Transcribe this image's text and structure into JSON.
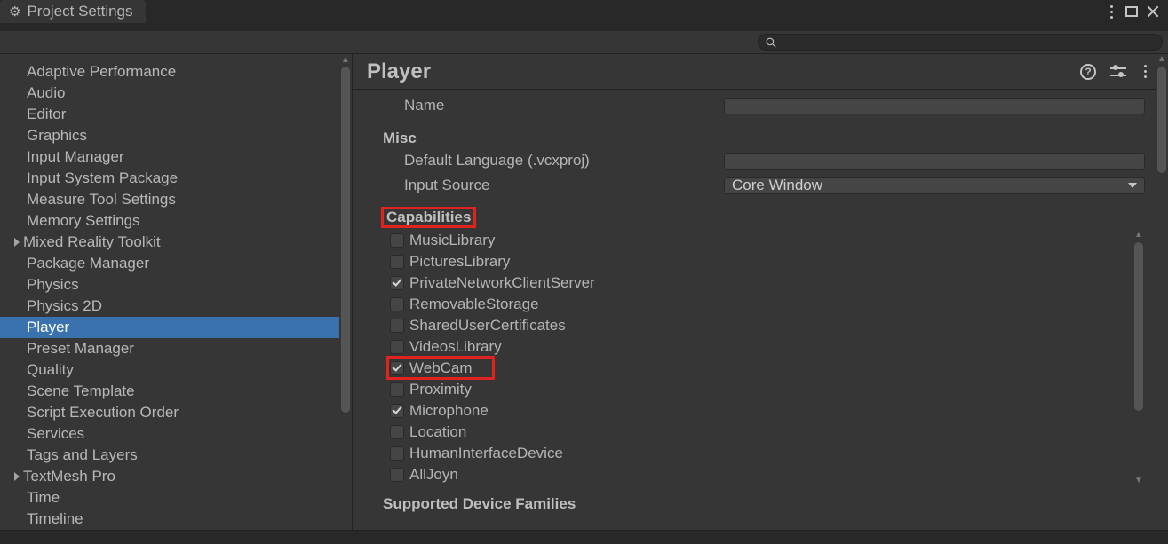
{
  "window": {
    "title": "Project Settings"
  },
  "sidebar": {
    "items": [
      {
        "label": "Adaptive Performance",
        "expandable": false
      },
      {
        "label": "Audio",
        "expandable": false
      },
      {
        "label": "Editor",
        "expandable": false
      },
      {
        "label": "Graphics",
        "expandable": false
      },
      {
        "label": "Input Manager",
        "expandable": false
      },
      {
        "label": "Input System Package",
        "expandable": false
      },
      {
        "label": "Measure Tool Settings",
        "expandable": false
      },
      {
        "label": "Memory Settings",
        "expandable": false
      },
      {
        "label": "Mixed Reality Toolkit",
        "expandable": true
      },
      {
        "label": "Package Manager",
        "expandable": false
      },
      {
        "label": "Physics",
        "expandable": false
      },
      {
        "label": "Physics 2D",
        "expandable": false
      },
      {
        "label": "Player",
        "expandable": false,
        "selected": true
      },
      {
        "label": "Preset Manager",
        "expandable": false
      },
      {
        "label": "Quality",
        "expandable": false
      },
      {
        "label": "Scene Template",
        "expandable": false
      },
      {
        "label": "Script Execution Order",
        "expandable": false
      },
      {
        "label": "Services",
        "expandable": false
      },
      {
        "label": "Tags and Layers",
        "expandable": false
      },
      {
        "label": "TextMesh Pro",
        "expandable": true
      },
      {
        "label": "Time",
        "expandable": false
      },
      {
        "label": "Timeline",
        "expandable": false
      }
    ]
  },
  "content": {
    "title": "Player",
    "name_label": "Name",
    "name_value": "",
    "misc_heading": "Misc",
    "default_language_label": "Default Language (.vcxproj)",
    "default_language_value": "",
    "input_source_label": "Input Source",
    "input_source_value": "Core Window",
    "capabilities_heading": "Capabilities",
    "capabilities": [
      {
        "label": "MusicLibrary",
        "checked": false
      },
      {
        "label": "PicturesLibrary",
        "checked": false
      },
      {
        "label": "PrivateNetworkClientServer",
        "checked": true
      },
      {
        "label": "RemovableStorage",
        "checked": false
      },
      {
        "label": "SharedUserCertificates",
        "checked": false
      },
      {
        "label": "VideosLibrary",
        "checked": false
      },
      {
        "label": "WebCam",
        "checked": true,
        "highlight": true
      },
      {
        "label": "Proximity",
        "checked": false
      },
      {
        "label": "Microphone",
        "checked": true
      },
      {
        "label": "Location",
        "checked": false
      },
      {
        "label": "HumanInterfaceDevice",
        "checked": false
      },
      {
        "label": "AllJoyn",
        "checked": false
      }
    ],
    "supported_families_heading": "Supported Device Families"
  }
}
